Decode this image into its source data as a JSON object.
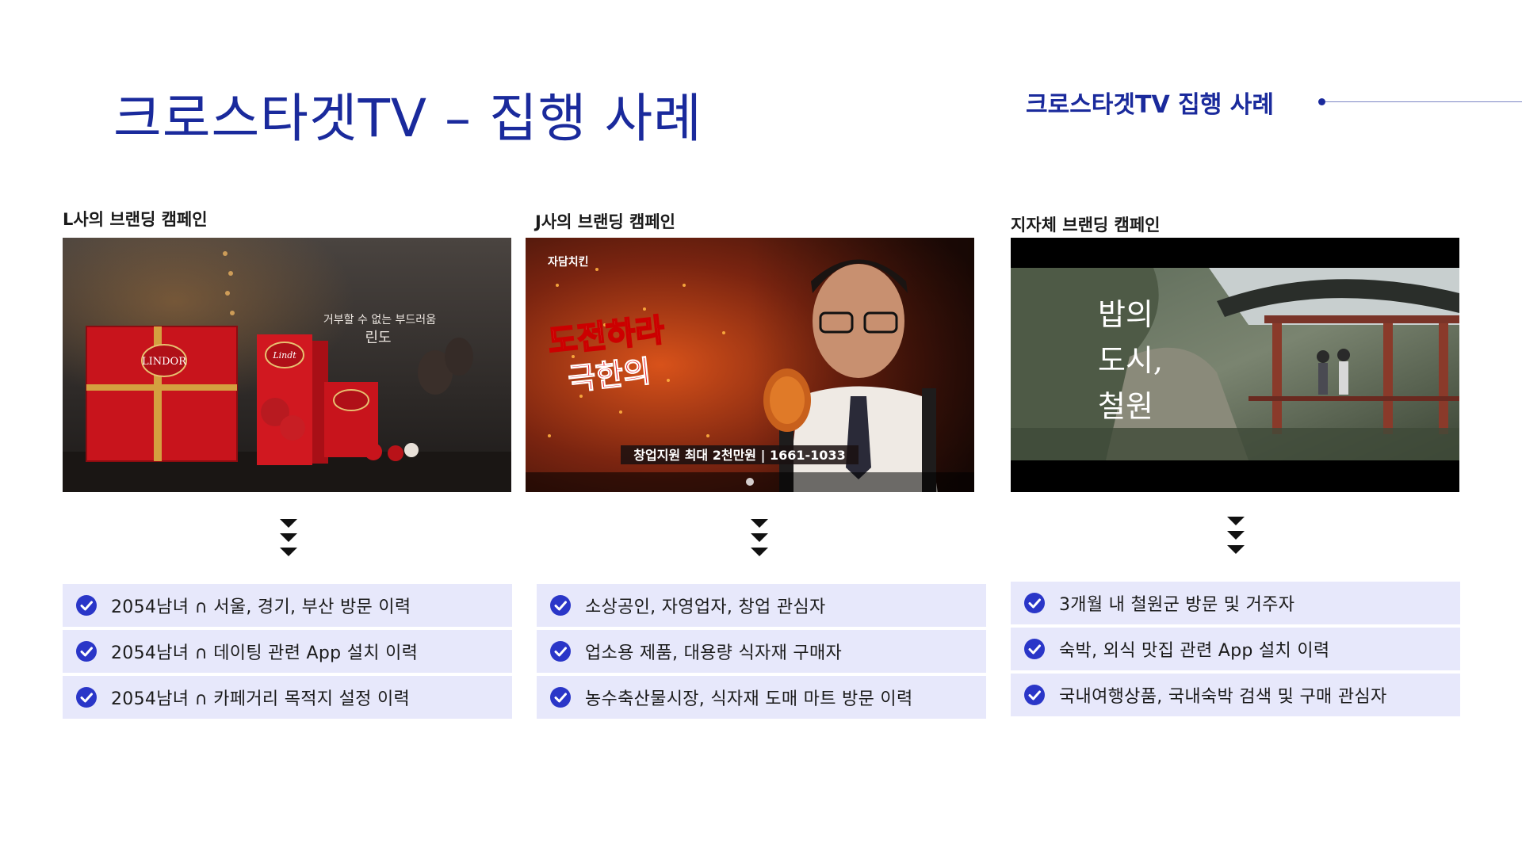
{
  "header": {
    "title": "크로스타겟TV – 집행 사례",
    "section_tag": "크로스타겟TV 집행 사례"
  },
  "campaigns": [
    {
      "label": "L사의 브랜딩 캠페인",
      "image": {
        "brand_box": "LINDOR",
        "brand_logo": "Lindt",
        "copy_line1": "거부할 수 없는 부드러움",
        "copy_line2": "린도"
      },
      "items": [
        "2054남녀 ∩ 서울, 경기, 부산 방문 이력",
        "2054남녀 ∩ 데이팅 관련 App 설치 이력",
        "2054남녀 ∩ 카페거리 목적지 설정 이력"
      ]
    },
    {
      "label": "J사의 브랜딩 캠페인",
      "image": {
        "logo": "자담치킨",
        "headline1": "도전하라",
        "headline2": "극한의",
        "banner": "창업지원 최대 2천만원 | 1661-1033"
      },
      "items": [
        "소상공인, 자영업자, 창업 관심자",
        "업소용 제품, 대용량 식자재 구매자",
        "농수축산물시장, 식자재 도매 마트 방문 이력"
      ]
    },
    {
      "label": "지자체 브랜딩 캠페인",
      "image": {
        "line1": "밥의",
        "line2": "도시,",
        "line3": "철원"
      },
      "items": [
        "3개월 내 철원군 방문 및 거주자",
        "숙박, 외식 맛집 관련 App 설치 이력",
        "국내여행상품, 국내숙박 검색 및 구매 관심자"
      ]
    }
  ],
  "colors": {
    "accent": "#1a2a9c",
    "check": "#2a36c8",
    "item_bg": "#e7e8fb"
  },
  "icons": {
    "check": "check-circle-icon",
    "arrow": "triple-down-arrow-icon"
  }
}
